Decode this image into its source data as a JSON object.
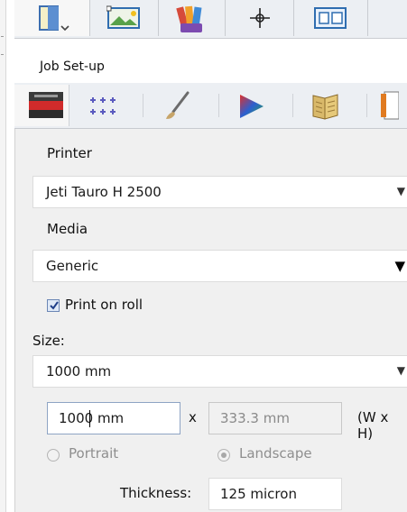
{
  "section_title": "Job Set-up",
  "printer": {
    "label": "Printer",
    "value": "Jeti Tauro H 2500"
  },
  "media": {
    "label": "Media",
    "value": "Generic"
  },
  "print_on_roll": {
    "label": "Print on roll",
    "checked": true
  },
  "size": {
    "label": "Size:",
    "preset_value": "1000 mm",
    "width_value": "1000 mm",
    "times_sign": "x",
    "height_value": "333.3 mm",
    "dims_hint": "(W x H)"
  },
  "orientation": {
    "portrait_label": "Portrait",
    "landscape_label": "Landscape",
    "selected": "Landscape"
  },
  "thickness": {
    "label": "Thickness:",
    "value": "125 micron"
  },
  "toolbar_icons": [
    "job-setup-icon",
    "image-placement-icon",
    "color-management-icon",
    "crosshair-icon",
    "layout-icon"
  ],
  "tab_icons": [
    "printer-tab-icon",
    "grid-tab-icon",
    "brush-tab-icon",
    "color-tab-icon",
    "book-tab-icon",
    "page-tab-icon"
  ]
}
